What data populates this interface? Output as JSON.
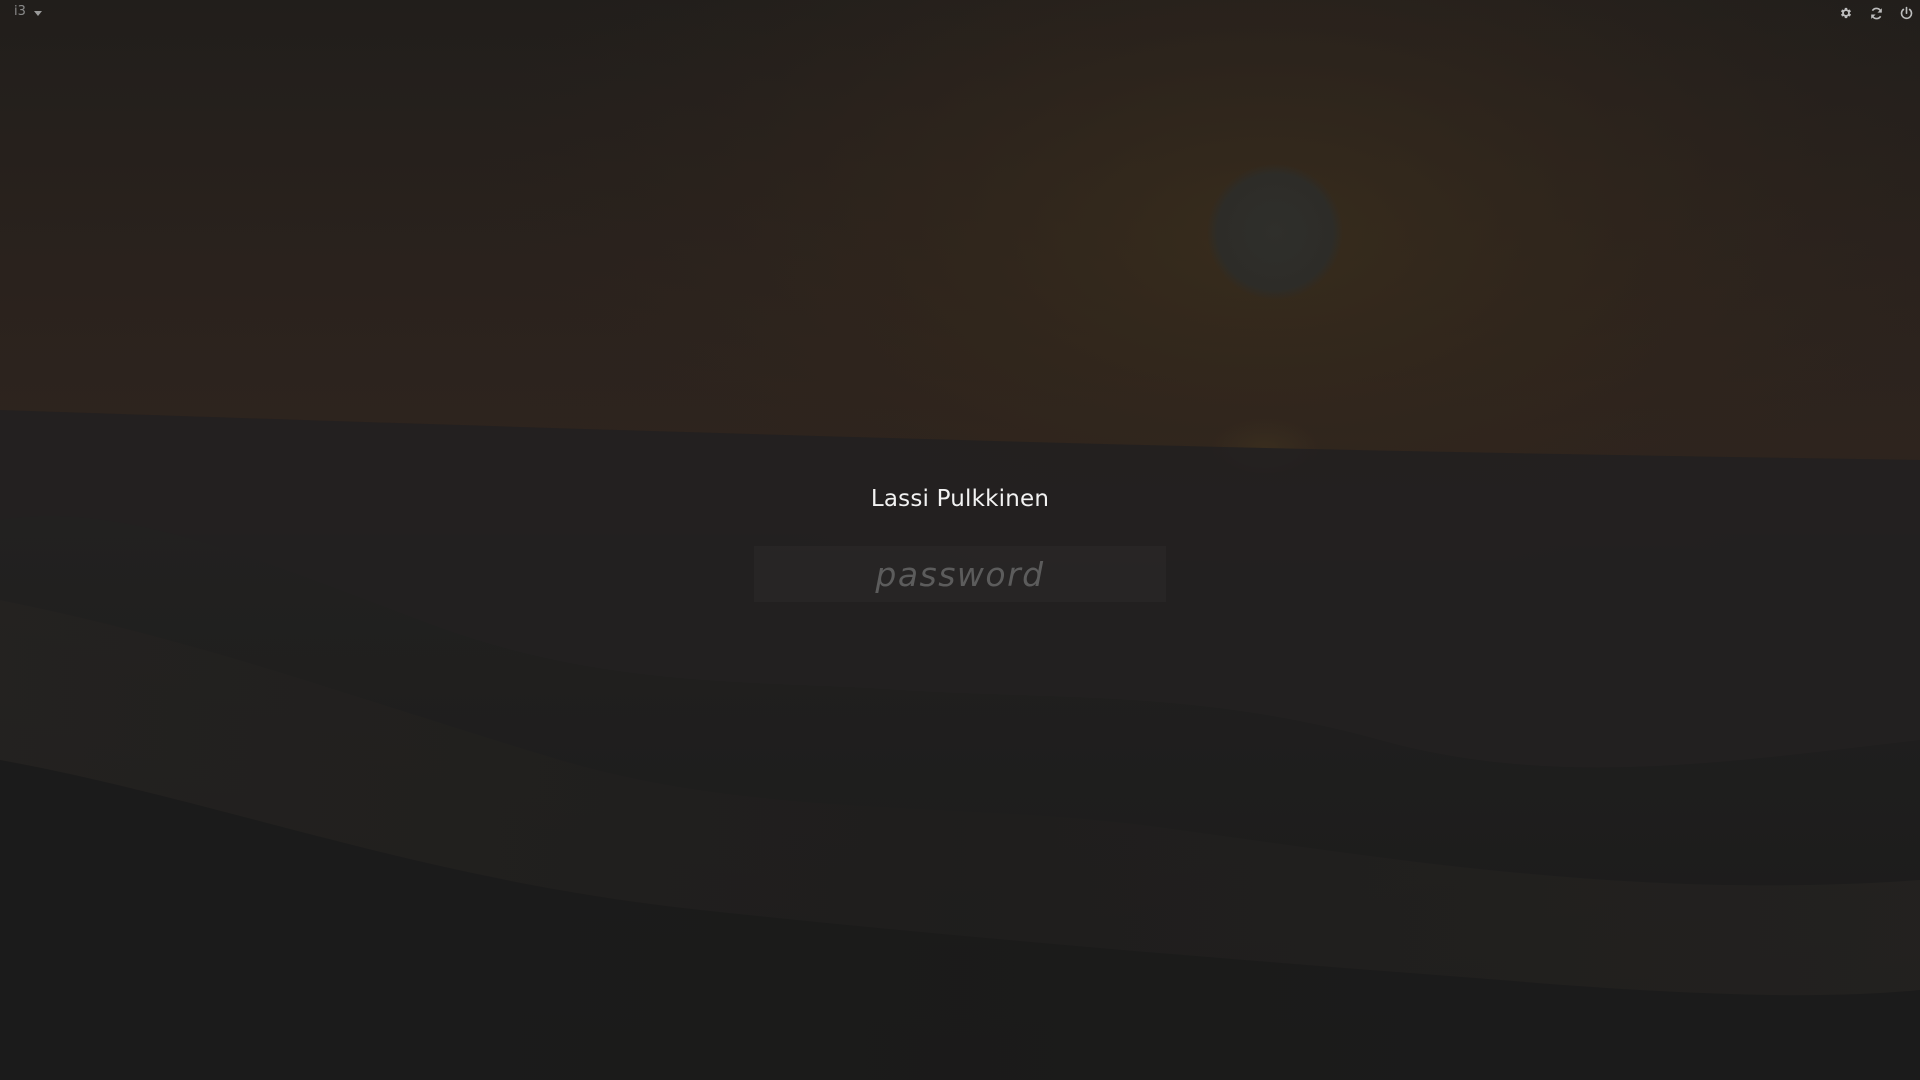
{
  "session": {
    "selected": "i3"
  },
  "user": {
    "name": "Lassi Pulkkinen"
  },
  "password": {
    "placeholder": "password",
    "value": ""
  },
  "topbar": {
    "actions": [
      {
        "icon": "gear-icon"
      },
      {
        "icon": "refresh-icon"
      },
      {
        "icon": "power-icon"
      }
    ]
  },
  "colors": {
    "text_primary": "#f2f2f2",
    "placeholder": "#5c5c5c",
    "icon": "#bdbdbd",
    "background": "#1f1f1f"
  }
}
